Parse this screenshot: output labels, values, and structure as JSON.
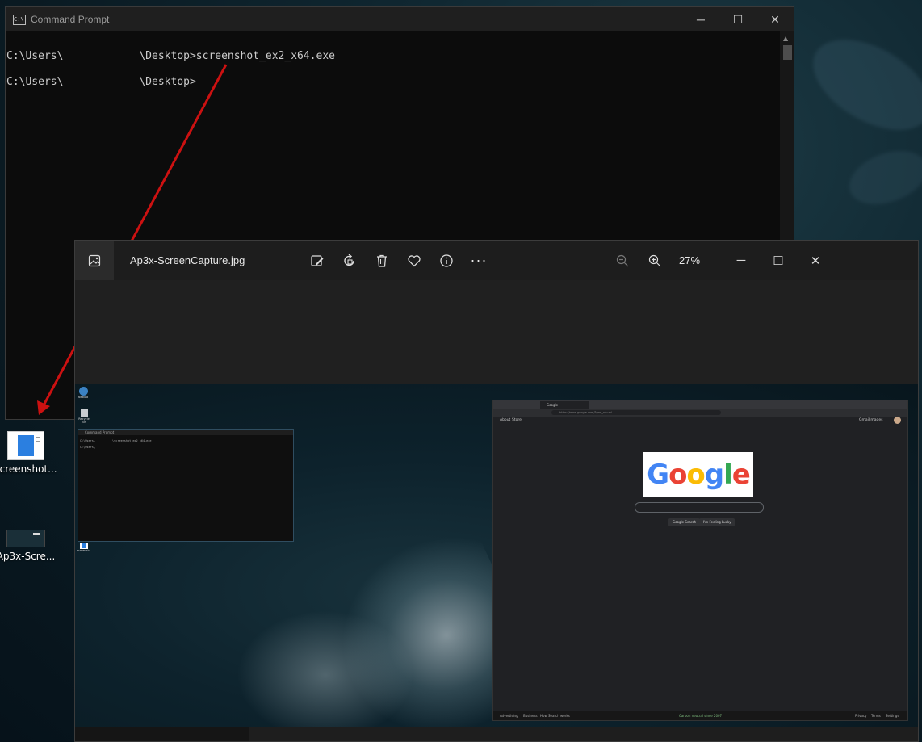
{
  "cmd_window": {
    "title": "Command Prompt",
    "icon_label": "C:\\",
    "controls": {
      "minimize": "─",
      "maximize": "☐",
      "close": "✕"
    },
    "lines": [
      "C:\\Users\\            \\Desktop>screenshot_ex2_x64.exe",
      "C:\\Users\\            \\Desktop>"
    ]
  },
  "desktop_icons": [
    {
      "label": "screenshot..."
    },
    {
      "label": "Ap3x-Scre..."
    }
  ],
  "photos_window": {
    "file_name": "Ap3x-ScreenCapture.jpg",
    "zoom": "27%",
    "toolbar": [
      "edit-icon",
      "rotate-icon",
      "delete-icon",
      "favorite-icon",
      "info-icon",
      "more-icon"
    ],
    "more_label": "···",
    "controls": {
      "minimize": "─",
      "maximize": "☐",
      "close": "✕"
    }
  },
  "captured_image": {
    "desktop_icons": [
      "Nebula",
      "Recycle Bin",
      "screensh..."
    ],
    "mini_cmd": {
      "title": "Command Prompt",
      "lines": [
        "C:\\Users\\          \\screenshot_ex2_x64.exe",
        "C:\\Users\\"
      ]
    },
    "browser": {
      "tab_label": "Google",
      "url": "https://www.google.com/?gws_rd=ssl",
      "nav_left": [
        "About",
        "Store"
      ],
      "nav_right": [
        "Gmail",
        "Images"
      ],
      "logo_text": "Google",
      "buttons": [
        "Google Search",
        "I'm Feeling Lucky"
      ],
      "footer_left": [
        "Advertising",
        "Business",
        "How Search works"
      ],
      "footer_center": "Carbon neutral since 2007",
      "footer_right": [
        "Privacy",
        "Terms",
        "Settings"
      ]
    }
  },
  "colors": {
    "arrow": "#cc1111",
    "cmd_bg": "#0c0c0c",
    "photos_bg": "#202020"
  }
}
